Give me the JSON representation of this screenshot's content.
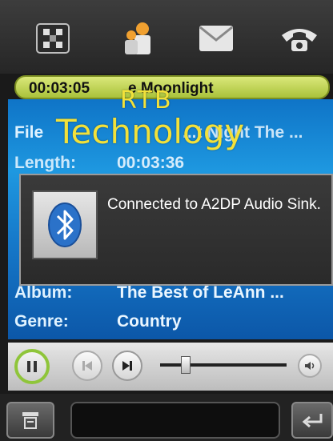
{
  "toolbar": {
    "icons": [
      "scan-icon",
      "contacts-icon",
      "mail-icon",
      "phone-icon"
    ]
  },
  "now_playing": {
    "time": "00:03:05",
    "title": "e Moonlight"
  },
  "info": {
    "file_label": "File",
    "file_value": "...t Night The ...",
    "length_label": "Length:",
    "length_value": "00:03:36",
    "album_label": "Album:",
    "album_value": "The Best of LeAnn ...",
    "genre_label": "Genre:",
    "genre_value": "Country"
  },
  "watermark": {
    "line1": "RTB",
    "line2": "Technology"
  },
  "popup": {
    "message": "Connected to A2DP Audio Sink."
  },
  "controls": {
    "progress": 0.2
  },
  "colors": {
    "accent_green": "#a9c23a",
    "panel_blue": "#1678c9",
    "watermark": "#f2e13a"
  }
}
